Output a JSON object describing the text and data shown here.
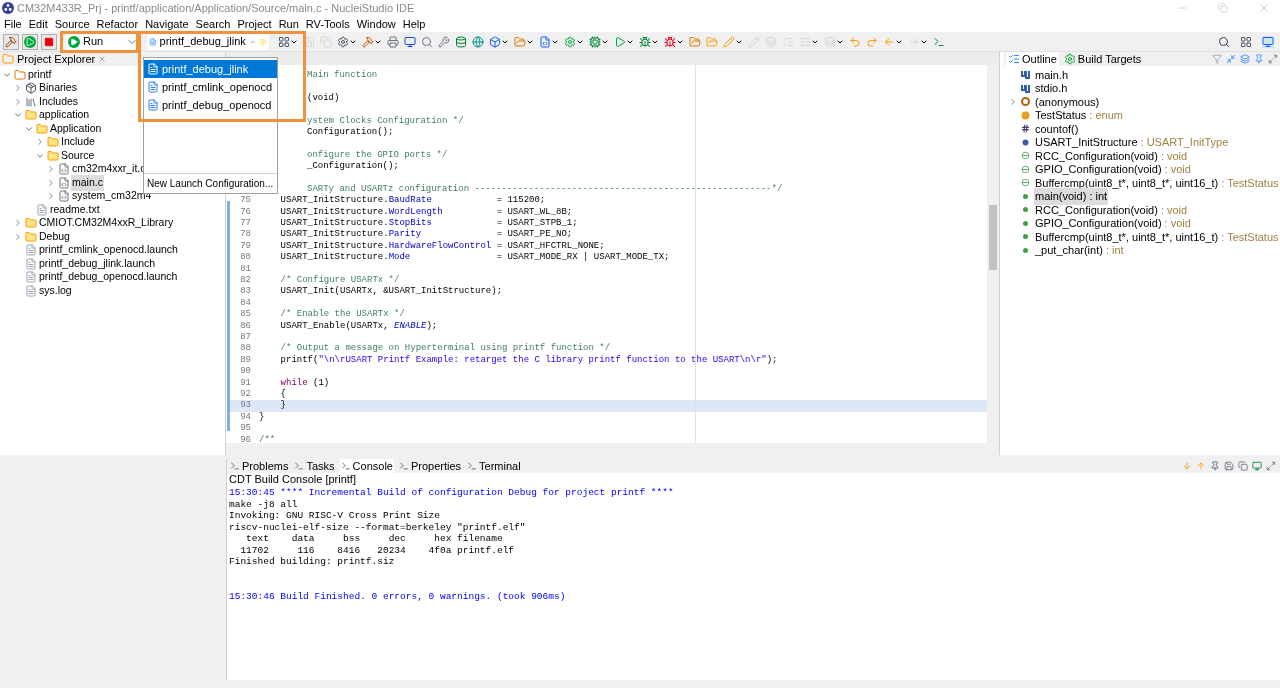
{
  "window": {
    "title": "CM32M433R_Prj - printf/application/Application/Source/main.c - NucleiStudio IDE"
  },
  "menu": [
    "File",
    "Edit",
    "Source",
    "Refactor",
    "Navigate",
    "Search",
    "Project",
    "Run",
    "RV-Tools",
    "Window",
    "Help"
  ],
  "toolbar": {
    "launch_mode": "Run",
    "launch_configuration": "printf_debug_jlink"
  },
  "launch_menu": {
    "items": [
      {
        "label": "printf_debug_jlink",
        "selected": true
      },
      {
        "label": "printf_cmlink_openocd",
        "selected": false
      },
      {
        "label": "printf_debug_openocd",
        "selected": false
      }
    ],
    "footer": "New Launch Configuration..."
  },
  "project_explorer": {
    "title": "Project Explorer",
    "tree": [
      {
        "label": "printf",
        "kind": "project",
        "expanded": true,
        "selected": false,
        "children": [
          {
            "label": "Binaries",
            "kind": "binaries",
            "expanded": false,
            "selected": false
          },
          {
            "label": "Includes",
            "kind": "includes",
            "expanded": false,
            "selected": false
          },
          {
            "label": "application",
            "kind": "folder",
            "expanded": true,
            "selected": false,
            "children": [
              {
                "label": "Application",
                "kind": "folder",
                "expanded": true,
                "selected": false,
                "children": [
                  {
                    "label": "Include",
                    "kind": "folder",
                    "expanded": false,
                    "selected": false
                  },
                  {
                    "label": "Source",
                    "kind": "folder",
                    "expanded": true,
                    "selected": false,
                    "children": [
                      {
                        "label": "cm32m4xxr_it.c",
                        "kind": "source",
                        "expanded": false,
                        "selected": false
                      },
                      {
                        "label": "main.c",
                        "kind": "source",
                        "expanded": false,
                        "selected": true
                      },
                      {
                        "label": "system_cm32m4",
                        "kind": "source",
                        "expanded": false,
                        "selected": false
                      }
                    ]
                  }
                ]
              },
              {
                "label": "readme.txt",
                "kind": "file",
                "selected": false
              }
            ]
          },
          {
            "label": "CMIOT.CM32M4xxR_Library",
            "kind": "folder",
            "expanded": false,
            "selected": false
          },
          {
            "label": "Debug",
            "kind": "folder",
            "expanded": false,
            "selected": false
          },
          {
            "label": "printf_cmlink_openocd.launch",
            "kind": "file",
            "selected": false
          },
          {
            "label": "printf_debug_jlink.launch",
            "kind": "file",
            "selected": false
          },
          {
            "label": "printf_debug_openocd.launch",
            "kind": "file",
            "selected": false
          },
          {
            "label": "sys.log",
            "kind": "file",
            "selected": false
          }
        ]
      }
    ]
  },
  "editor": {
    "lines": [
      {
        "kind": "partial",
        "segments": [
          {
            "text": "Main function",
            "kind": "comment"
          }
        ]
      },
      {
        "kind": "blank"
      },
      {
        "kind": "partial",
        "segments": [
          {
            "text": "(void)",
            "kind": "plain"
          }
        ]
      },
      {
        "kind": "blank"
      },
      {
        "kind": "partial",
        "segments": [
          {
            "text": "ystem Clocks Configuration */",
            "kind": "comment"
          }
        ]
      },
      {
        "kind": "partial",
        "segments": [
          {
            "text": "Configuration();",
            "kind": "plain"
          }
        ]
      },
      {
        "kind": "blank"
      },
      {
        "kind": "partial",
        "segments": [
          {
            "text": "onfigure the GPIO ports */",
            "kind": "comment"
          }
        ]
      },
      {
        "kind": "partial",
        "segments": [
          {
            "text": "_Configuration();",
            "kind": "plain"
          }
        ]
      },
      {
        "kind": "blank"
      },
      {
        "kind": "partial",
        "segments": [
          {
            "text": "SARTy and USARTz configuration -------------------------------------------------------*/",
            "kind": "comment"
          }
        ]
      },
      {
        "kind": "numbered",
        "number": "75",
        "current": false,
        "segments": [
          {
            "text": "    USART_InitStructure.",
            "kind": "plain"
          },
          {
            "text": "BaudRate",
            "kind": "field"
          },
          {
            "text": "            = 115200;",
            "kind": "plain"
          }
        ]
      },
      {
        "kind": "numbered",
        "number": "76",
        "current": false,
        "segments": [
          {
            "text": "    USART_InitStructure.",
            "kind": "plain"
          },
          {
            "text": "WordLength",
            "kind": "field"
          },
          {
            "text": "          = USART_WL_8B;",
            "kind": "plain"
          }
        ]
      },
      {
        "kind": "numbered",
        "number": "77",
        "current": false,
        "segments": [
          {
            "text": "    USART_InitStructure.",
            "kind": "plain"
          },
          {
            "text": "StopBits",
            "kind": "field"
          },
          {
            "text": "            = USART_STPB_1;",
            "kind": "plain"
          }
        ]
      },
      {
        "kind": "numbered",
        "number": "78",
        "current": false,
        "segments": [
          {
            "text": "    USART_InitStructure.",
            "kind": "plain"
          },
          {
            "text": "Parity",
            "kind": "field"
          },
          {
            "text": "              = USART_PE_NO;",
            "kind": "plain"
          }
        ]
      },
      {
        "kind": "numbered",
        "number": "79",
        "current": false,
        "segments": [
          {
            "text": "    USART_InitStructure.",
            "kind": "plain"
          },
          {
            "text": "HardwareFlowControl",
            "kind": "field"
          },
          {
            "text": " = USART_HFCTRL_NONE;",
            "kind": "plain"
          }
        ]
      },
      {
        "kind": "numbered",
        "number": "80",
        "current": false,
        "segments": [
          {
            "text": "    USART_InitStructure.",
            "kind": "plain"
          },
          {
            "text": "Mode",
            "kind": "field"
          },
          {
            "text": "                = USART_MODE_RX | USART_MODE_TX;",
            "kind": "plain"
          }
        ]
      },
      {
        "kind": "numbered",
        "number": "81",
        "current": false
      },
      {
        "kind": "numbered",
        "number": "82",
        "current": false,
        "segments": [
          {
            "text": "    /* Configure USARTx */",
            "kind": "comment"
          }
        ]
      },
      {
        "kind": "numbered",
        "number": "83",
        "current": false,
        "segments": [
          {
            "text": "    USART_Init(USARTx, &USART_InitStructure);",
            "kind": "plain"
          }
        ]
      },
      {
        "kind": "numbered",
        "number": "84",
        "current": false
      },
      {
        "kind": "numbered",
        "number": "85",
        "current": false,
        "segments": [
          {
            "text": "    /* Enable the USARTx */",
            "kind": "comment"
          }
        ]
      },
      {
        "kind": "numbered",
        "number": "86",
        "current": false,
        "segments": [
          {
            "text": "    USART_Enable(USARTx, ",
            "kind": "plain"
          },
          {
            "text": "ENABLE",
            "kind": "constant"
          },
          {
            "text": ");",
            "kind": "plain"
          }
        ]
      },
      {
        "kind": "numbered",
        "number": "87",
        "current": false
      },
      {
        "kind": "numbered",
        "number": "88",
        "current": false,
        "segments": [
          {
            "text": "    /* Output a message on Hyperterminal using printf function */",
            "kind": "comment"
          }
        ]
      },
      {
        "kind": "numbered",
        "number": "89",
        "current": false,
        "segments": [
          {
            "text": "    printf(",
            "kind": "plain"
          },
          {
            "text": "\"\\n\\rUSART Printf Example: retarget the C library printf function to the USART\\n\\r\"",
            "kind": "string"
          },
          {
            "text": ");",
            "kind": "plain"
          }
        ]
      },
      {
        "kind": "numbered",
        "number": "90",
        "current": false
      },
      {
        "kind": "numbered",
        "number": "91",
        "current": false,
        "segments": [
          {
            "text": "    while",
            "kind": "keyword"
          },
          {
            "text": " (1)",
            "kind": "plain"
          }
        ]
      },
      {
        "kind": "numbered",
        "number": "92",
        "current": false,
        "segments": [
          {
            "text": "    {",
            "kind": "plain"
          }
        ]
      },
      {
        "kind": "numbered",
        "number": "93",
        "current": true,
        "segments": [
          {
            "text": "    }",
            "kind": "plain"
          }
        ]
      },
      {
        "kind": "numbered",
        "number": "94",
        "current": false,
        "segments": [
          {
            "text": "}",
            "kind": "plain"
          }
        ]
      },
      {
        "kind": "numbered",
        "number": "95",
        "current": false
      },
      {
        "kind": "numbered",
        "number": "96",
        "current": false,
        "segments": [
          {
            "text": "/**",
            "kind": "comment"
          }
        ]
      }
    ]
  },
  "outline": {
    "tabs": [
      {
        "label": "Outline",
        "selected": true
      },
      {
        "label": "Build Targets",
        "selected": false
      }
    ],
    "items": [
      {
        "name": "main.h",
        "kind": "include",
        "selected": false
      },
      {
        "name": "stdio.h",
        "kind": "include",
        "selected": false
      },
      {
        "name": "(anonymous)",
        "kind": "struct",
        "selected": false,
        "expanded": false
      },
      {
        "name": "TestStatus",
        "type": ": enum",
        "kind": "enum",
        "selected": false
      },
      {
        "name": "countof()",
        "kind": "macro",
        "selected": false
      },
      {
        "name": "USART_InitStructure",
        "type": ": USART_InitType",
        "kind": "variable",
        "selected": false
      },
      {
        "name": "RCC_Configuration(void)",
        "type": ": void",
        "kind": "declaration",
        "selected": false
      },
      {
        "name": "GPIO_Configuration(void)",
        "type": ": void",
        "kind": "declaration",
        "selected": false
      },
      {
        "name": "Buffercmp(uint8_t*, uint8_t*, uint16_t)",
        "type": ": TestStatus",
        "kind": "declaration",
        "selected": false
      },
      {
        "name": "main(void) : int",
        "kind": "function",
        "selected": true
      },
      {
        "name": "RCC_Configuration(void)",
        "type": ": void",
        "kind": "function",
        "selected": false
      },
      {
        "name": "GPIO_Configuration(void)",
        "type": ": void",
        "kind": "function",
        "selected": false
      },
      {
        "name": "Buffercmp(uint8_t*, uint8_t*, uint16_t)",
        "type": ": TestStatus",
        "kind": "function",
        "selected": false
      },
      {
        "name": "_put_char(int)",
        "type": ": int",
        "kind": "function",
        "selected": false
      }
    ]
  },
  "console": {
    "tabs": [
      {
        "label": "Problems",
        "selected": false
      },
      {
        "label": "Tasks",
        "selected": false
      },
      {
        "label": "Console",
        "selected": true
      },
      {
        "label": "Properties",
        "selected": false
      },
      {
        "label": "Terminal",
        "selected": false
      }
    ],
    "title": "CDT Build Console [printf]",
    "lines": [
      {
        "kind": "info",
        "text": "15:30:45 **** Incremental Build of configuration Debug for project printf ****"
      },
      {
        "kind": "plain",
        "text": "make -j8 all"
      },
      {
        "kind": "plain",
        "text": "Invoking: GNU RISC-V Cross Print Size"
      },
      {
        "kind": "plain",
        "text": "riscv-nuclei-elf-size --format=berkeley \"printf.elf\""
      },
      {
        "kind": "plain",
        "text": "   text    data     bss     dec     hex filename"
      },
      {
        "kind": "plain",
        "text": "  11702     116    8416   20234    4f0a printf.elf"
      },
      {
        "kind": "plain",
        "text": "Finished building: printf.siz"
      },
      {
        "kind": "blank"
      },
      {
        "kind": "blank"
      },
      {
        "kind": "info",
        "text": "15:30:46 Build Finished. 0 errors, 0 warnings. (took 906ms)"
      }
    ]
  }
}
